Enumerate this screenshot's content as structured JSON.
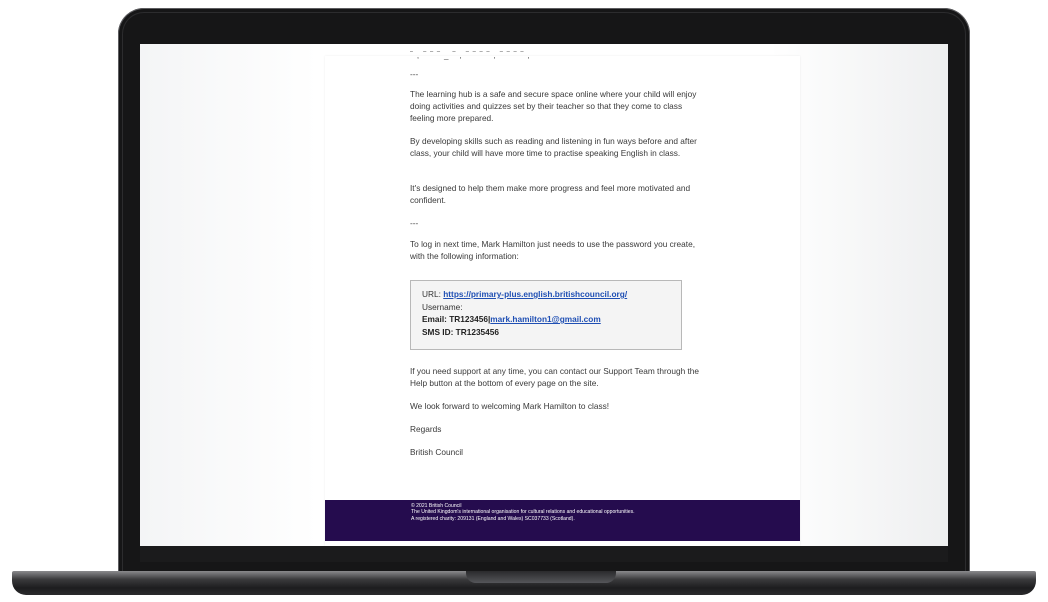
{
  "email": {
    "top_cut_text": "‾ , ‾ ‾ ‾ _ ‾ , ‾ ‾ ‾ ‾ , ‾ ‾ ‾ ‾ ,",
    "separator_1": "---",
    "paragraph_1": "The learning hub is a safe and secure space online where your child will enjoy doing activities and quizzes set by their teacher so that they come to class feeling more prepared.",
    "paragraph_2": "By developing skills such as reading and listening in fun ways before and after class, your child will have more time to practise speaking English in class.",
    "paragraph_3": "It's designed to help them make more progress and feel more motivated and confident.",
    "separator_2": "---",
    "paragraph_4": "To log in next time,  Mark Hamilton just needs to use the password you create, with the following information:",
    "login_info": {
      "url_label": "URL: ",
      "url_link": "https://primary-plus.english.britishcouncil.org/",
      "username_label": "Username:",
      "email_label": "Email: ",
      "email_id": "TR123456|",
      "email_link": "mark.hamilton1@gmail.com",
      "sms_label": "SMS ID: ",
      "sms_value": "TR1235456"
    },
    "paragraph_5": "If you need support at any time, you can contact our Support Team through the Help button at the bottom of every page on the site.",
    "paragraph_6": "We look forward to welcoming Mark Hamilton to class!",
    "regards": "Regards",
    "signature": "British Council"
  },
  "footer": {
    "copyright": "© 2021 British Council",
    "line_1": "The United Kingdom's international organisation for cultural relations and educational opportunities.",
    "line_2": "A registered charity: 209131 (England and Wales) SC037733 (Scotland)."
  },
  "colors": {
    "footer_bg": "#250c4e",
    "link": "#1f4fb4"
  }
}
